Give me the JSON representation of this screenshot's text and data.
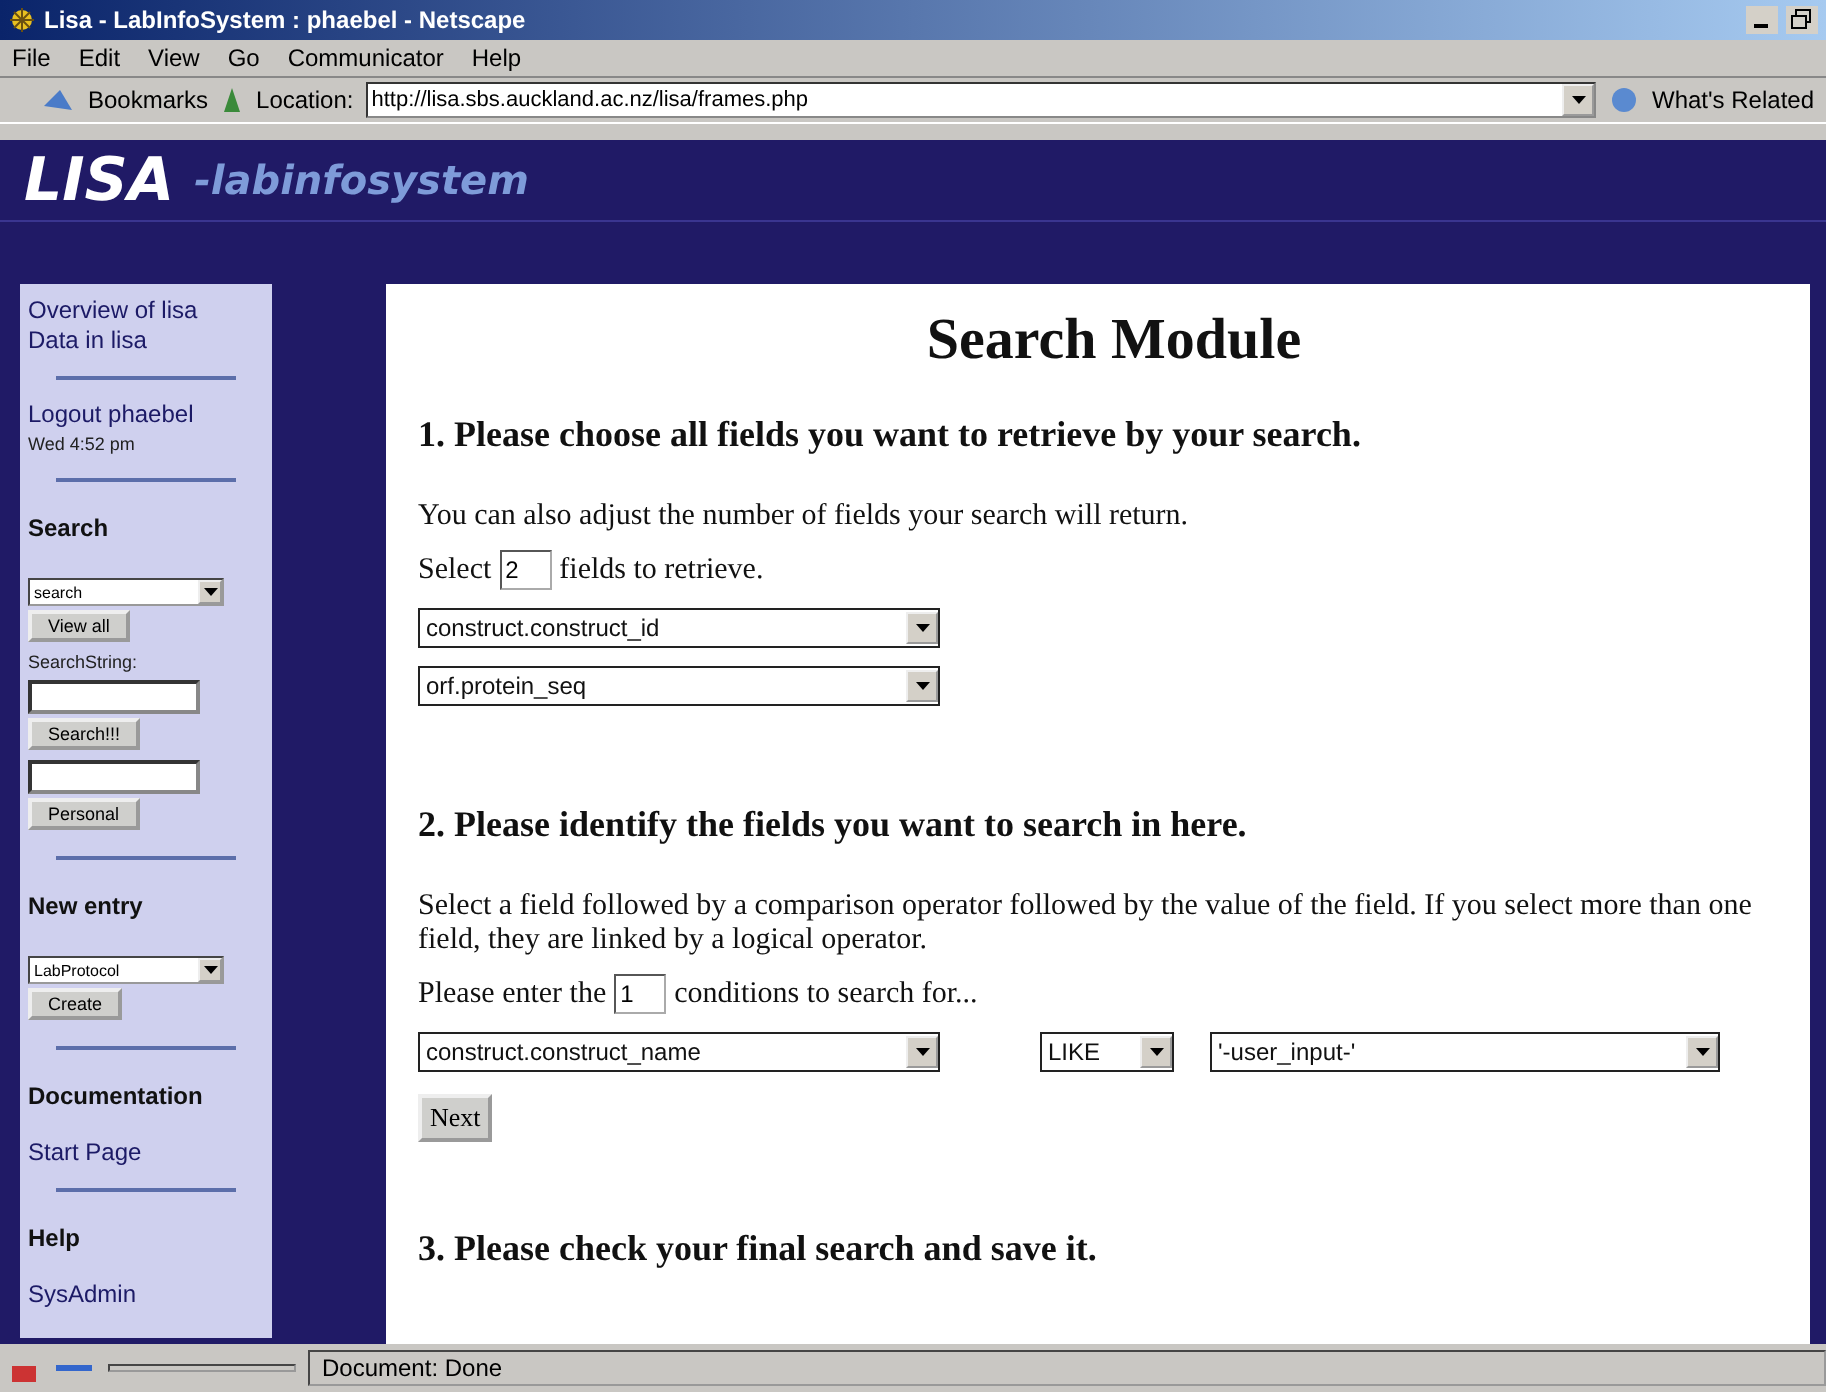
{
  "window": {
    "title": "Lisa - LabInfoSystem : phaebel - Netscape"
  },
  "menu": [
    "File",
    "Edit",
    "View",
    "Go",
    "Communicator",
    "Help"
  ],
  "toolbar": {
    "bookmarks": "Bookmarks",
    "location_label": "Location:",
    "url": "http://lisa.sbs.auckland.ac.nz/lisa/frames.php",
    "related": "What's Related"
  },
  "banner": {
    "logo": "LISA",
    "tagline": "-labinfosystem"
  },
  "sidebar": {
    "items": [
      {
        "kind": "link",
        "text": "Overview of lisa"
      },
      {
        "kind": "link",
        "text": "Data in lisa"
      },
      {
        "kind": "divider"
      },
      {
        "kind": "link",
        "text": "Logout phaebel"
      },
      {
        "kind": "small",
        "text": "Wed 4:52 pm"
      },
      {
        "kind": "divider"
      },
      {
        "kind": "heading",
        "text": "Search"
      },
      {
        "kind": "select",
        "text": "search"
      },
      {
        "kind": "button",
        "text": "View all"
      },
      {
        "kind": "small",
        "text": "SearchString:"
      },
      {
        "kind": "input"
      },
      {
        "kind": "button",
        "text": "Search!!!"
      },
      {
        "kind": "input"
      },
      {
        "kind": "button",
        "text": "Personal"
      },
      {
        "kind": "divider"
      },
      {
        "kind": "heading",
        "text": "New entry"
      },
      {
        "kind": "select",
        "text": "LabProtocol"
      },
      {
        "kind": "button",
        "text": "Create"
      },
      {
        "kind": "divider"
      },
      {
        "kind": "heading",
        "text": "Documentation"
      },
      {
        "kind": "link",
        "text": "Start Page"
      },
      {
        "kind": "divider"
      },
      {
        "kind": "heading",
        "text": "Help"
      },
      {
        "kind": "link",
        "text": "SysAdmin"
      }
    ]
  },
  "main": {
    "title": "Search Module",
    "section_1": {
      "heading": "1. Please choose all fields you want to retrieve by your search.",
      "text": "You can also adjust the number of fields your search will return.",
      "count_before": "Select",
      "count": "2",
      "count_after": "fields to retrieve.",
      "selects": [
        "construct.construct_id",
        "orf.protein_seq"
      ]
    },
    "section_2": {
      "heading": "2. Please identify the fields you want to search in here.",
      "text": "Select a field followed by a comparison operator followed by the value of the field. If you select more than one field, they are linked by a logical operator.",
      "count_before": "Please enter the",
      "count": "1",
      "count_after": "conditions to search for...",
      "field": "construct.construct_name",
      "operator": "LIKE",
      "value": "'-user_input-'",
      "button": "Next"
    },
    "section_3": {
      "heading": "3. Please check your final search and save it."
    }
  },
  "status_bar": {
    "text": "Document: Done"
  }
}
